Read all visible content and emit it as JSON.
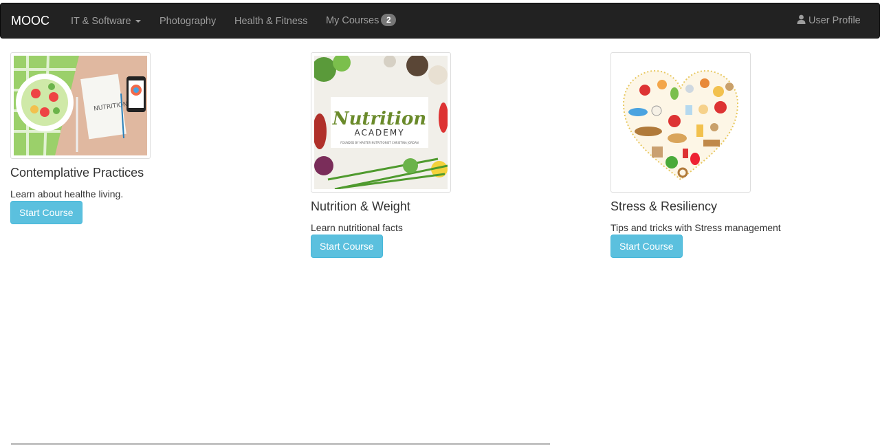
{
  "navbar": {
    "brand": "MOOC",
    "items": [
      {
        "label": "IT & Software",
        "dropdown": true
      },
      {
        "label": "Photography"
      },
      {
        "label": "Health & Fitness"
      },
      {
        "label": "My Courses",
        "badge": "2"
      }
    ],
    "user_profile": "User Profile",
    "icons": {
      "user": "user-icon",
      "caret": "caret-down-icon"
    }
  },
  "courses": [
    {
      "title": "Contemplative Practices",
      "description": "Learn about healthe living.",
      "button": "Start Course",
      "image": {
        "art": "salad-notebook-phone",
        "notebook_text": "NUTRITION 101"
      }
    },
    {
      "title": "Nutrition & Weight",
      "description": "Learn nutritional facts",
      "button": "Start Course",
      "image": {
        "art": "herbs-frame",
        "title_script": "Nutrition",
        "title_caps": "ACADEMY",
        "subtitle": "FOUNDED BY MASTER NUTRITIONIST CHRISTINA JORDAN"
      }
    },
    {
      "title": "Stress & Resiliency",
      "description": "Tips and tricks with Stress management",
      "button": "Start Course",
      "image": {
        "art": "food-heart"
      }
    }
  ],
  "colors": {
    "navbar_bg": "#222222",
    "nav_text": "#9d9d9d",
    "button": "#5bc0de",
    "badge": "#777777"
  }
}
